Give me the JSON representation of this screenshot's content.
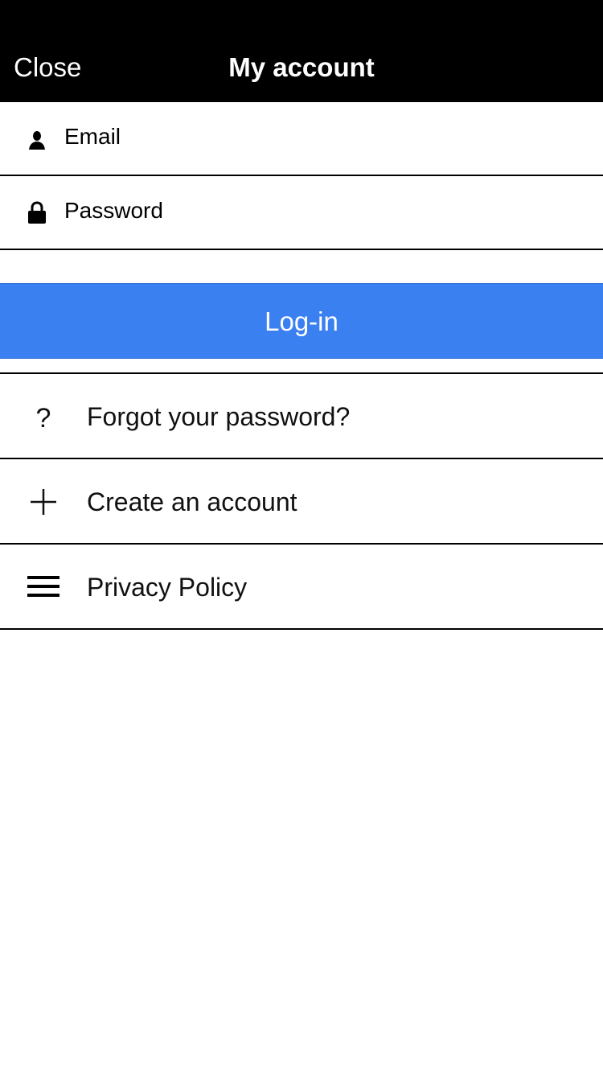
{
  "navbar": {
    "close_label": "Close",
    "title": "My account"
  },
  "form": {
    "email_placeholder": "Email",
    "password_placeholder": "Password",
    "login_label": "Log-in"
  },
  "menu": {
    "items": [
      {
        "label": "Forgot your password?",
        "icon": "question-icon"
      },
      {
        "label": "Create an account",
        "icon": "plus-icon"
      },
      {
        "label": "Privacy Policy",
        "icon": "menu-lines-icon"
      }
    ]
  },
  "colors": {
    "navbar_bg": "#000000",
    "accent": "#3a80f1"
  }
}
